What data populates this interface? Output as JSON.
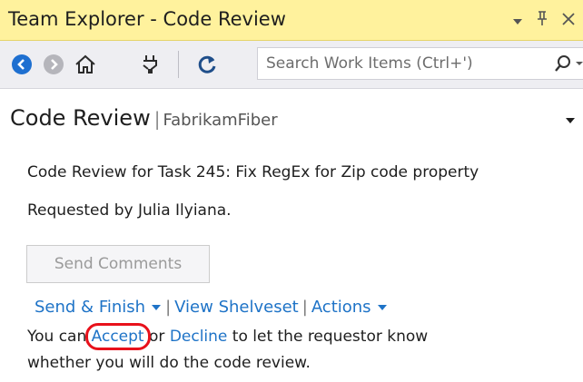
{
  "window": {
    "title": "Team Explorer - Code Review",
    "title_bar_color": "#fff29d",
    "controls": [
      {
        "icon": "dropdown-arrow-icon",
        "glyph": "▾"
      },
      {
        "icon": "pin-icon",
        "glyph": "ꟸ"
      },
      {
        "icon": "close-icon",
        "glyph": "✕"
      }
    ]
  },
  "toolbar": {
    "buttons": [
      "back-icon",
      "forward-icon",
      "home-icon",
      "connect-icon",
      "refresh-icon"
    ],
    "search_placeholder": "Search Work Items (Ctrl+')",
    "search_icon": "search-icon"
  },
  "header": {
    "title": "Code Review",
    "separator": "|",
    "project": "FabrikamFiber"
  },
  "review": {
    "summary": "Code Review for Task 245: Fix RegEx for Zip code property",
    "requested_by": "Requested by Julia Ilyiana."
  },
  "send_comments_label": "Send Comments",
  "actions": {
    "send_finish": "Send & Finish",
    "separator": "|",
    "view_shelveset": "View Shelveset",
    "actions": "Actions"
  },
  "message": {
    "prefix": "You can ",
    "accept": "Accept",
    "middle": " or ",
    "decline": "Decline",
    "suffix": " to let the requestor know",
    "line2": "whether you will do the code review."
  },
  "colors": {
    "link": "#1e73c7",
    "highlight_ring": "#e8111b",
    "nav_blue": "#1e6fd0"
  }
}
